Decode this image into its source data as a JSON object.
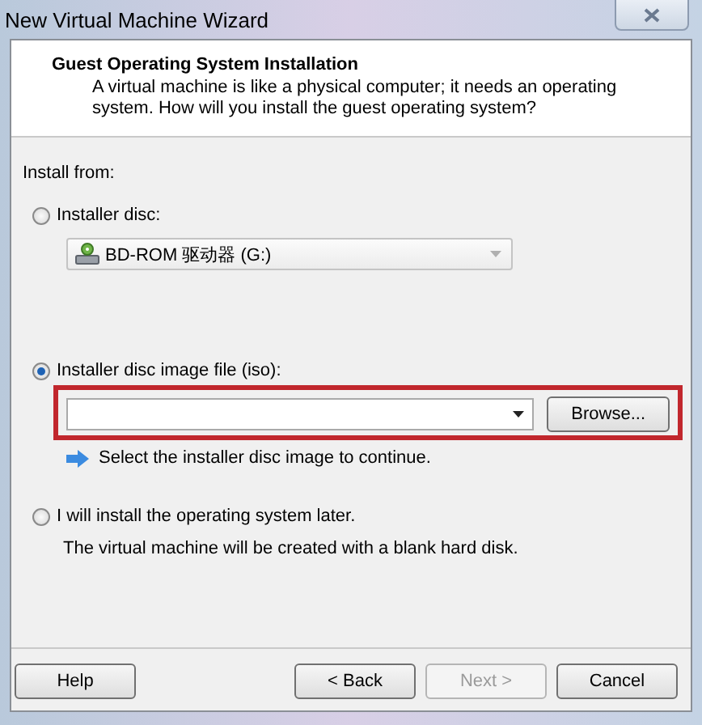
{
  "window": {
    "title": "New Virtual Machine Wizard"
  },
  "header": {
    "title": "Guest Operating System Installation",
    "description": "A virtual machine is like a physical computer; it needs an operating system. How will you install the guest operating system?"
  },
  "install_from_label": "Install from:",
  "options": [
    {
      "kind": "drive",
      "label": "Installer disc:",
      "selected": false,
      "drive": {
        "label": "BD-ROM 驱动器 (G:)",
        "disabled": true
      }
    },
    {
      "kind": "iso",
      "label": "Installer disc image file (iso):",
      "selected": true,
      "browse_label": "Browse...",
      "hint": "Select the installer disc image to continue."
    },
    {
      "kind": "later",
      "label": "I will install the operating system later.",
      "selected": false,
      "note": "The virtual machine will be created with a blank hard disk."
    }
  ],
  "buttons": [
    {
      "label": "Help",
      "disabled": false
    },
    {
      "label": "< Back",
      "disabled": false
    },
    {
      "label": "Next >",
      "disabled": true
    },
    {
      "label": "Cancel",
      "disabled": false
    }
  ]
}
